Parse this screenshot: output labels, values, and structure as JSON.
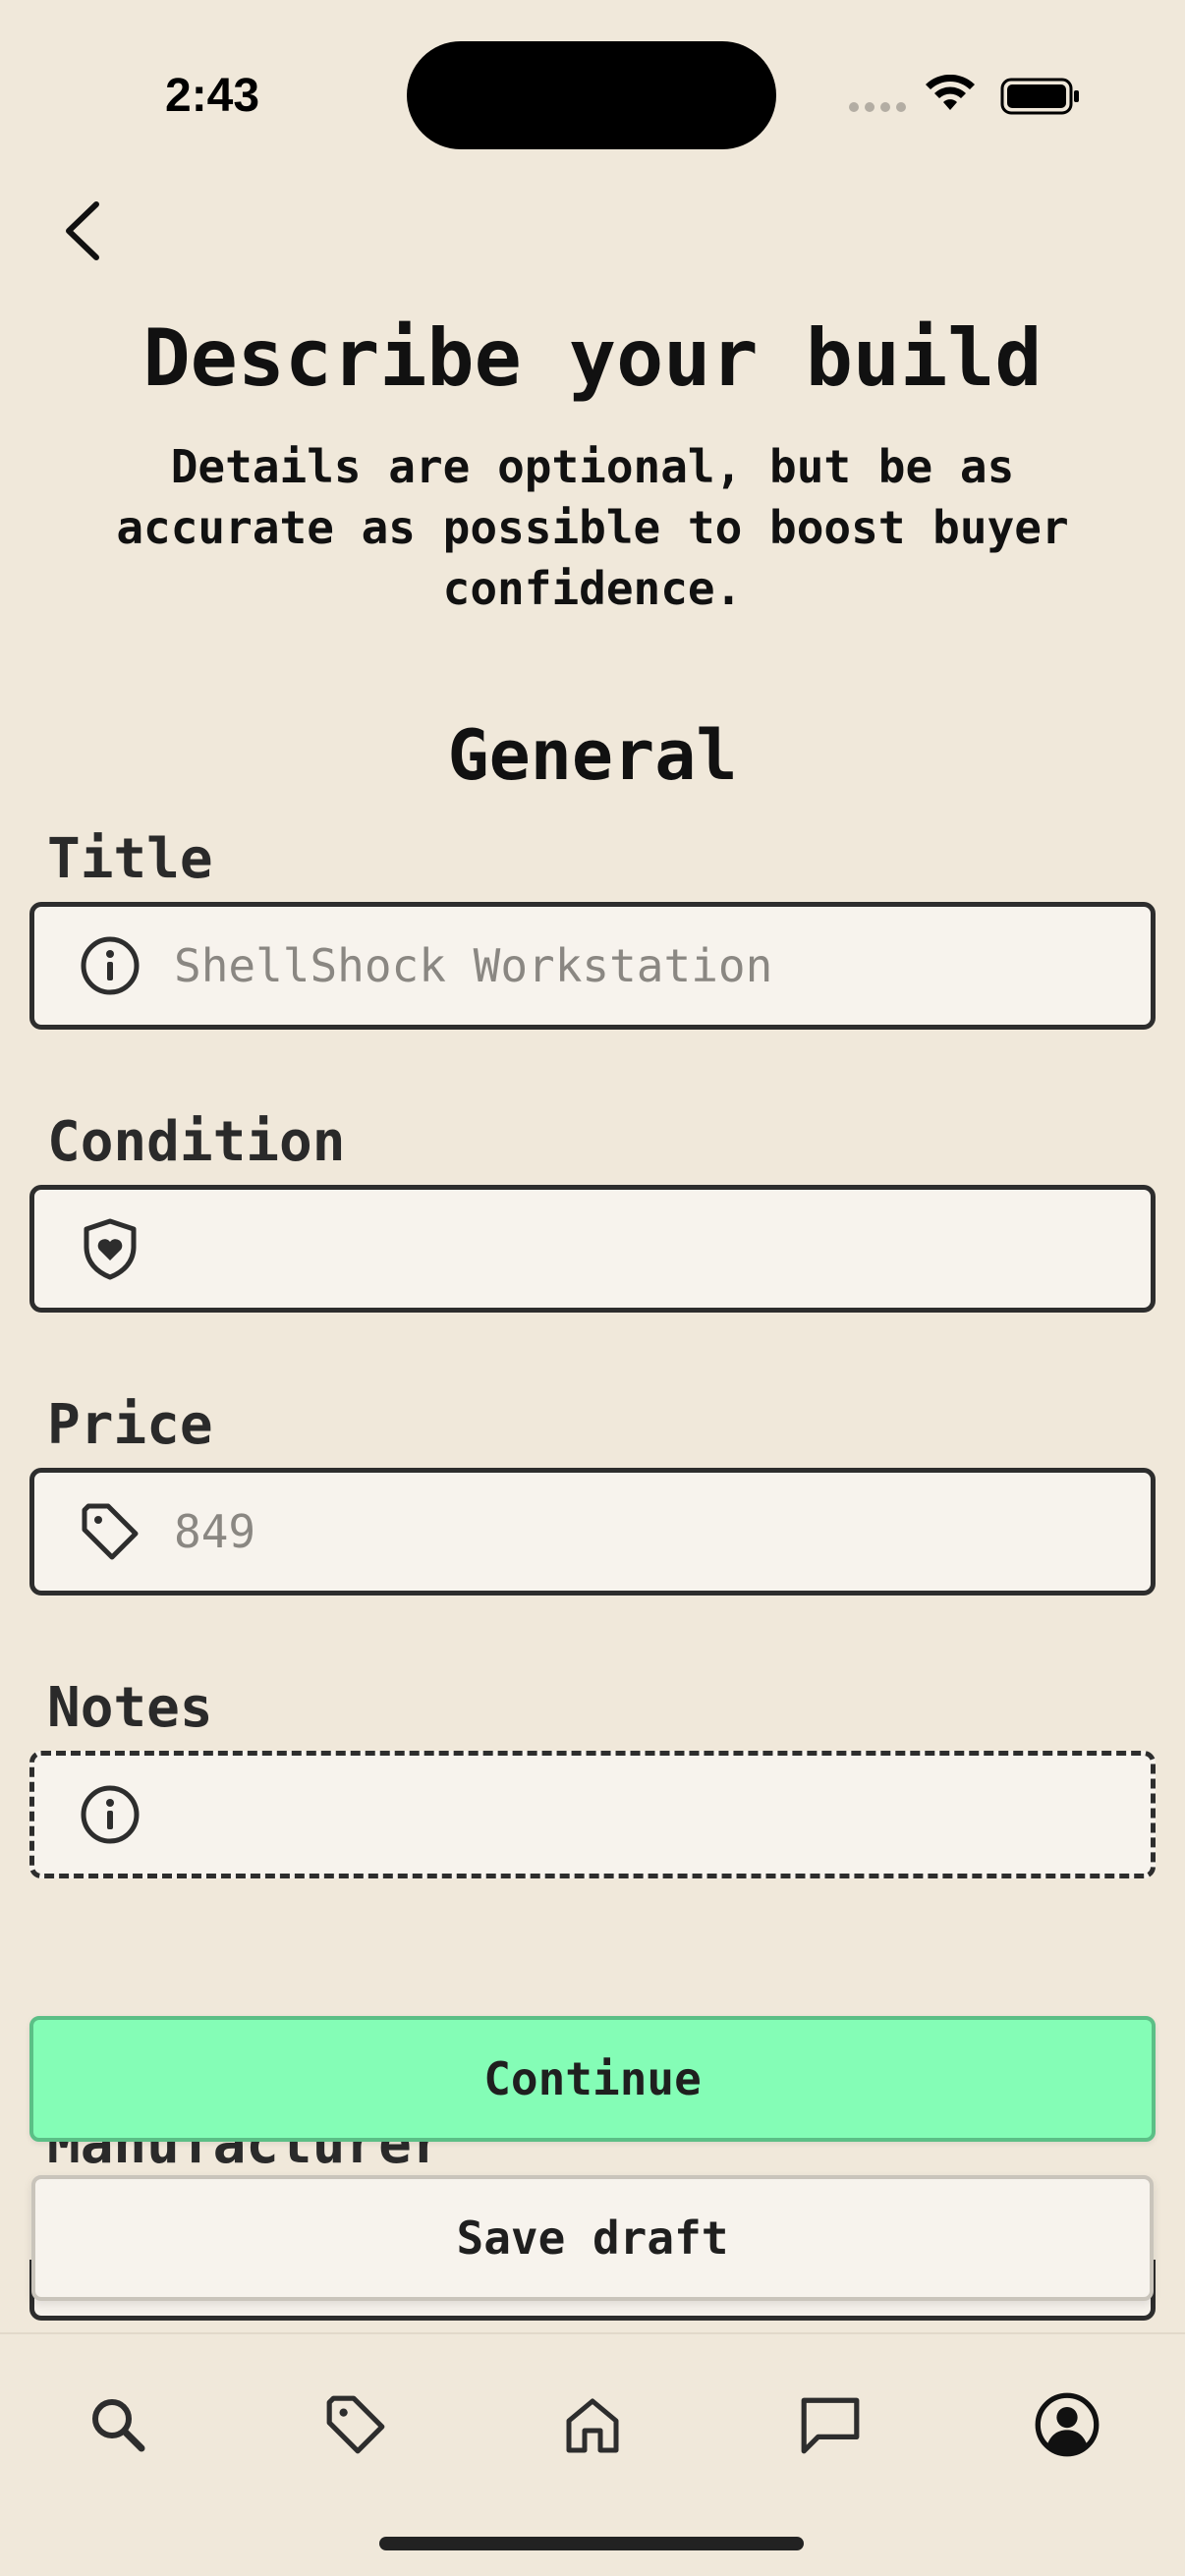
{
  "status_bar": {
    "time": "2:43"
  },
  "header": {
    "title": "Describe your build",
    "subtitle": "Details are optional, but be as accurate as possible to boost buyer confidence."
  },
  "section": {
    "title": "General"
  },
  "fields": {
    "title": {
      "label": "Title",
      "placeholder": "ShellShock Workstation",
      "icon": "info-icon"
    },
    "condition": {
      "label": "Condition",
      "value": "",
      "icon": "shield-heart-icon"
    },
    "price": {
      "label": "Price",
      "placeholder": "849",
      "icon": "tag-icon"
    },
    "notes": {
      "label": "Notes",
      "value": "",
      "icon": "info-icon"
    },
    "manufacturer": {
      "label": "Manufacturer"
    }
  },
  "actions": {
    "continue": "Continue",
    "save_draft": "Save draft"
  },
  "colors": {
    "background": "#f0e8da",
    "accent": "#84fdb6",
    "field": "#f7f3ed"
  },
  "tabbar": [
    "search-icon",
    "tag-icon",
    "home-icon",
    "chat-icon",
    "profile-icon"
  ]
}
